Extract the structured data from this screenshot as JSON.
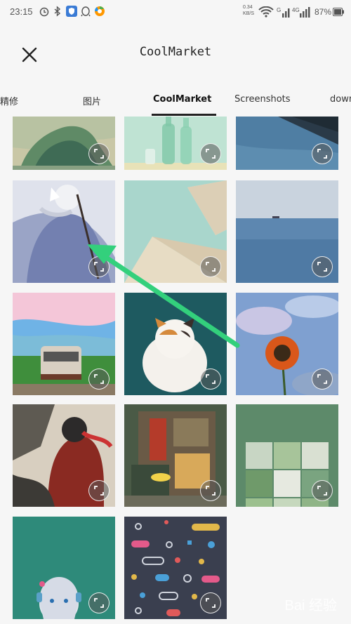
{
  "status_bar": {
    "time": "23:15",
    "network_speed": "0.34\nKB/S",
    "battery": "87%"
  },
  "app_bar": {
    "title": "CoolMarket",
    "close_icon": "close-icon"
  },
  "tabs": [
    {
      "label": "精修",
      "active": false
    },
    {
      "label": "图片",
      "active": false
    },
    {
      "label": "CoolMarket",
      "active": true
    },
    {
      "label": "Screenshots",
      "active": false
    },
    {
      "label": "down",
      "active": false
    }
  ],
  "grid": {
    "images": [
      {
        "description": "anime landscape wave",
        "select_icon": "expand-icon"
      },
      {
        "description": "green glass bottles",
        "select_icon": "expand-icon"
      },
      {
        "description": "pier over water",
        "select_icon": "expand-icon"
      },
      {
        "description": "anime figure with white fox",
        "select_icon": "expand-icon"
      },
      {
        "description": "abstract geometric pastel",
        "select_icon": "expand-icon"
      },
      {
        "description": "calm blue sea",
        "select_icon": "expand-icon"
      },
      {
        "description": "anime train under cherry blossoms",
        "select_icon": "expand-icon"
      },
      {
        "description": "white and orange cat",
        "select_icon": "expand-icon"
      },
      {
        "description": "sunflower against sky",
        "select_icon": "expand-icon"
      },
      {
        "description": "anime character red jacket",
        "select_icon": "expand-icon"
      },
      {
        "description": "illustrated street shop",
        "select_icon": "expand-icon"
      },
      {
        "description": "green photo collage",
        "select_icon": "expand-icon"
      },
      {
        "description": "anime girl with headphones",
        "select_icon": "expand-icon"
      },
      {
        "description": "dotted geometric pattern",
        "select_icon": "expand-icon"
      }
    ]
  },
  "watermark": "Bai 经验"
}
